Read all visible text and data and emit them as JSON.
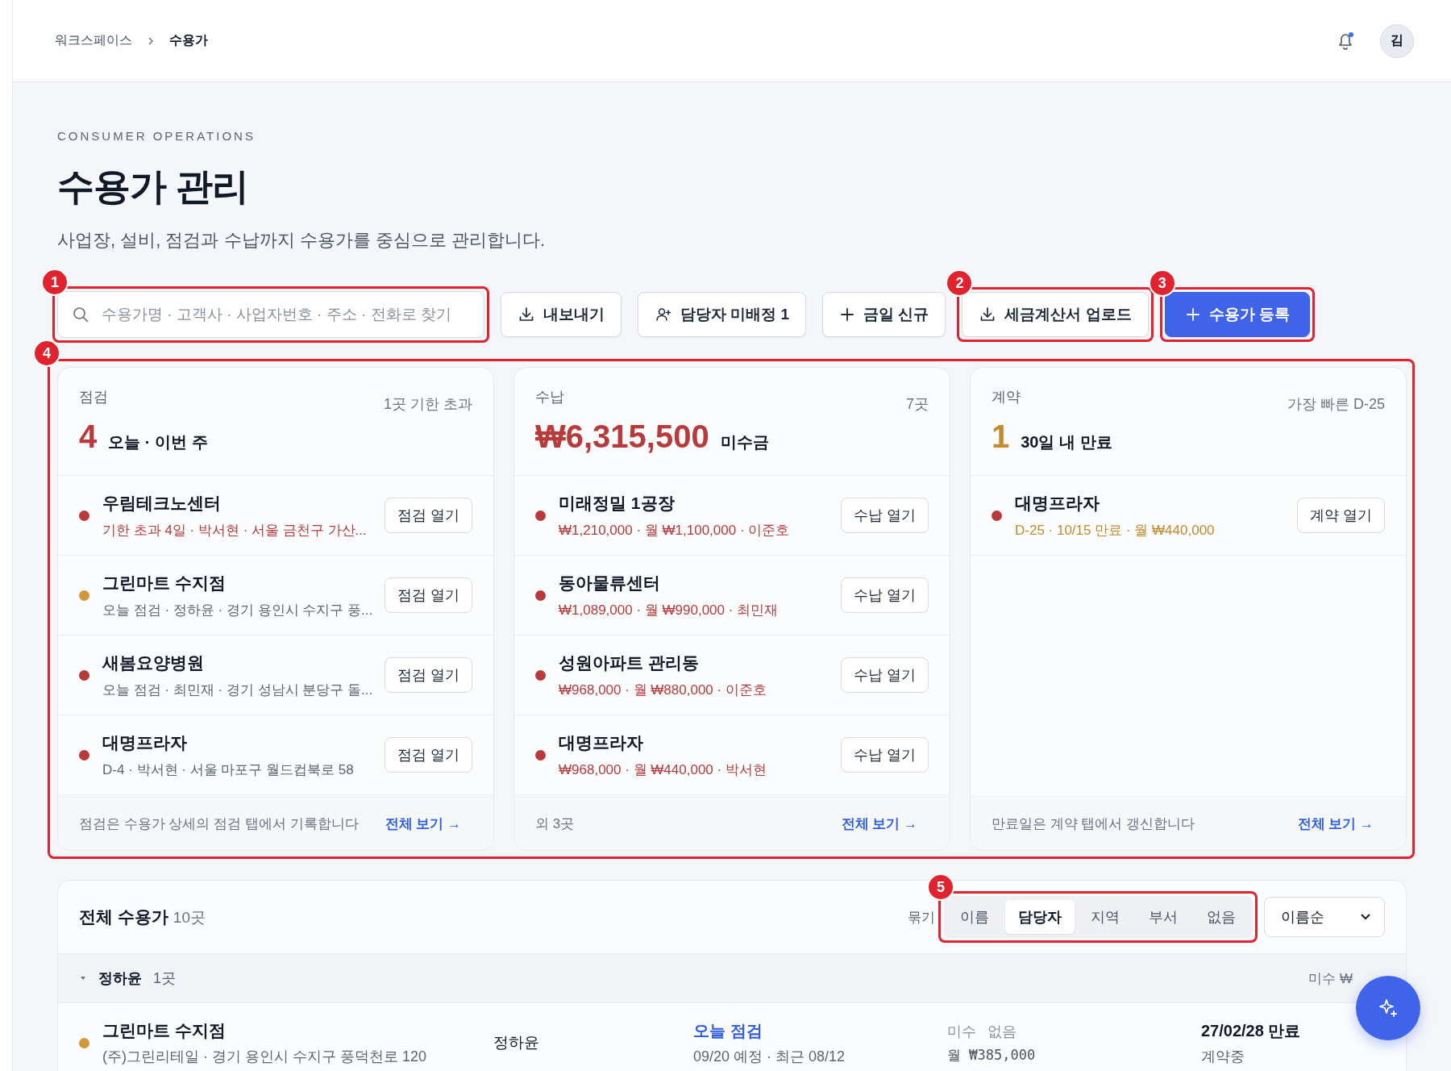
{
  "breadcrumb": [
    "워크스페이스",
    "수용가"
  ],
  "header": {
    "avatar": "김",
    "notification_dot": true
  },
  "eyebrow": "CONSUMER OPERATIONS",
  "title": "수용가 관리",
  "subtitle": "사업장, 설비, 점검과 수납까지 수용가를 중심으로 관리합니다.",
  "search": {
    "placeholder": "수용가명 · 고객사 · 사업자번호 · 주소 · 전화로 찾기",
    "annotation": "1"
  },
  "toolbar_buttons": [
    {
      "label": "내보내기",
      "kind": "download",
      "primary": false
    },
    {
      "label": "담당자 미배정 1",
      "kind": "assign",
      "primary": false
    },
    {
      "label": "금일 신규",
      "kind": "add",
      "primary": false
    },
    {
      "label": "세금계산서 업로드",
      "kind": "download",
      "primary": false,
      "annotation": "2"
    },
    {
      "label": "수용가 등록",
      "kind": "add",
      "primary": true,
      "annotation": "3"
    }
  ],
  "cards_annotation": "4",
  "cards": [
    {
      "label": "점검",
      "meta": "1곳 기한 초과",
      "value": {
        "text": "4",
        "color": "#b83a3a"
      },
      "value_caption": "오늘 · 이번 주",
      "items": [
        {
          "name": "우림테크노센터",
          "detail": {
            "text": "기한 초과 4일 · 박서현 · 서울 금천구 가산...",
            "color": "#b83a3a"
          },
          "color": "#b83a3a",
          "action": "점검 열기"
        },
        {
          "name": "그린마트 수지점",
          "detail": {
            "text": "오늘 점검 · 정하윤 · 경기 용인시 수지구 풍...",
            "color": "#5b6473"
          },
          "color": "#d4973a",
          "action": "점검 열기"
        },
        {
          "name": "새봄요양병원",
          "detail": {
            "text": "오늘 점검 · 최민재 · 경기 성남시 분당구 돌...",
            "color": "#5b6473"
          },
          "color": "#b83a3a",
          "action": "점검 열기"
        },
        {
          "name": "대명프라자",
          "detail": {
            "text": "D-4 · 박서현 · 서울 마포구 월드컵북로 58",
            "color": "#5b6473"
          },
          "color": "#b83a3a",
          "action": "점검 열기"
        }
      ],
      "footer": "점검은 수용가 상세의 점검 탭에서 기록합니다",
      "link": "전체 보기 →"
    },
    {
      "label": "수납",
      "meta": "7곳",
      "value": {
        "text": "₩6,315,500",
        "color": "#b83a3a"
      },
      "value_caption": "미수금",
      "items": [
        {
          "name": "미래정밀 1공장",
          "detail": {
            "text": "₩1,210,000 · 월 ₩1,100,000 · 이준호",
            "color": "#b83a3a"
          },
          "color": "#b83a3a",
          "action": "수납 열기"
        },
        {
          "name": "동아물류센터",
          "detail": {
            "text": "₩1,089,000 · 월 ₩990,000 · 최민재",
            "color": "#b83a3a"
          },
          "color": "#b83a3a",
          "action": "수납 열기"
        },
        {
          "name": "성원아파트 관리동",
          "detail": {
            "text": "₩968,000 · 월 ₩880,000 · 이준호",
            "color": "#b83a3a"
          },
          "color": "#b83a3a",
          "action": "수납 열기"
        },
        {
          "name": "대명프라자",
          "detail": {
            "text": "₩968,000 · 월 ₩440,000 · 박서현",
            "color": "#b83a3a"
          },
          "color": "#b83a3a",
          "action": "수납 열기"
        }
      ],
      "footer": "외 3곳",
      "link": "전체 보기 →"
    },
    {
      "label": "계약",
      "meta": "가장 빠른 D-25",
      "value": {
        "text": "1",
        "color": "#c58a2c"
      },
      "value_caption": "30일 내 만료",
      "items": [
        {
          "name": "대명프라자",
          "detail": {
            "text": "D-25 · 10/15 만료 · 월 ₩440,000",
            "color": "#c58a2c"
          },
          "color": "#b83a3a",
          "action": "계약 열기"
        }
      ],
      "footer": "만료일은 계약 탭에서 갱신합니다",
      "link": "전체 보기 →"
    }
  ],
  "list": {
    "title": "전체 수용가",
    "count": "10곳",
    "group_label": "묶기",
    "group_annotation": "5",
    "group_options": [
      {
        "label": "이름",
        "selected": false
      },
      {
        "label": "담당자",
        "selected": true
      },
      {
        "label": "지역",
        "selected": false
      },
      {
        "label": "부서",
        "selected": false
      },
      {
        "label": "없음",
        "selected": false
      }
    ],
    "sort": "이름순",
    "groups": [
      {
        "name": "정하윤",
        "count": "1곳",
        "expanded": true,
        "summary": "미수 ₩",
        "rows": [
          {
            "name": "그린마트 수지점",
            "sub": "(주)그린리테일 · 경기 용인시 수지구 풍덕천로 120",
            "color": "#d4973a",
            "manager": "정하윤",
            "status": "오늘 점검",
            "schedule": "09/20 예정 · 최근 08/12",
            "due_label": "미수",
            "due_value": "없음",
            "monthly": "월 ₩385,000",
            "contract": "27/02/28 만료",
            "contract_state": "계약중"
          }
        ]
      }
    ]
  }
}
